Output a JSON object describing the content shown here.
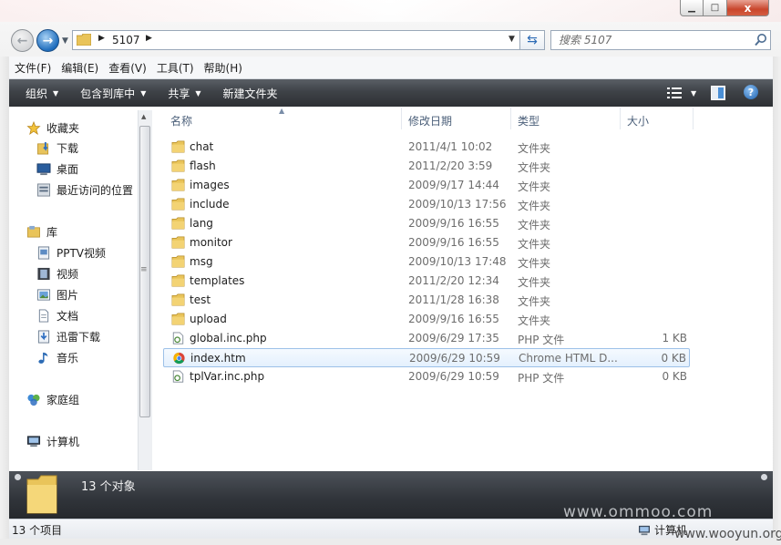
{
  "window": {
    "min_icon": "minimize-icon",
    "max_icon": "maximize-icon",
    "close_icon": "close-icon",
    "close_glyph": "x"
  },
  "address": {
    "crumb": "5107",
    "search_placeholder": "搜索 5107"
  },
  "menu": [
    "文件(F)",
    "编辑(E)",
    "查看(V)",
    "工具(T)",
    "帮助(H)"
  ],
  "commands": [
    {
      "label": "组织",
      "dropdown": true
    },
    {
      "label": "包含到库中",
      "dropdown": true
    },
    {
      "label": "共享",
      "dropdown": true
    },
    {
      "label": "新建文件夹",
      "dropdown": false
    }
  ],
  "help_glyph": "?",
  "nav": {
    "favorites": "收藏夹",
    "favorites_items": [
      "下载",
      "桌面",
      "最近访问的位置"
    ],
    "libraries": "库",
    "libraries_items": [
      "PPTV视频",
      "视频",
      "图片",
      "文档",
      "迅雷下载",
      "音乐"
    ],
    "homegroup": "家庭组",
    "computer": "计算机"
  },
  "columns": {
    "name": "名称",
    "date": "修改日期",
    "type": "类型",
    "size": "大小"
  },
  "files": [
    {
      "name": "chat",
      "date": "2011/4/1 10:02",
      "type": "文件夹",
      "size": "",
      "icon": "folder"
    },
    {
      "name": "flash",
      "date": "2011/2/20 3:59",
      "type": "文件夹",
      "size": "",
      "icon": "folder"
    },
    {
      "name": "images",
      "date": "2009/9/17 14:44",
      "type": "文件夹",
      "size": "",
      "icon": "folder"
    },
    {
      "name": "include",
      "date": "2009/10/13 17:56",
      "type": "文件夹",
      "size": "",
      "icon": "folder"
    },
    {
      "name": "lang",
      "date": "2009/9/16 16:55",
      "type": "文件夹",
      "size": "",
      "icon": "folder"
    },
    {
      "name": "monitor",
      "date": "2009/9/16 16:55",
      "type": "文件夹",
      "size": "",
      "icon": "folder"
    },
    {
      "name": "msg",
      "date": "2009/10/13 17:48",
      "type": "文件夹",
      "size": "",
      "icon": "folder"
    },
    {
      "name": "templates",
      "date": "2011/2/20 12:34",
      "type": "文件夹",
      "size": "",
      "icon": "folder"
    },
    {
      "name": "test",
      "date": "2011/1/28 16:38",
      "type": "文件夹",
      "size": "",
      "icon": "folder"
    },
    {
      "name": "upload",
      "date": "2009/9/16 16:55",
      "type": "文件夹",
      "size": "",
      "icon": "folder"
    },
    {
      "name": "global.inc.php",
      "date": "2009/6/29 17:35",
      "type": "PHP 文件",
      "size": "1 KB",
      "icon": "php-file"
    },
    {
      "name": "index.htm",
      "date": "2009/6/29 10:59",
      "type": "Chrome HTML D...",
      "size": "0 KB",
      "icon": "chrome-html-file",
      "selected": true
    },
    {
      "name": "tplVar.inc.php",
      "date": "2009/6/29 10:59",
      "type": "PHP 文件",
      "size": "0 KB",
      "icon": "php-file"
    }
  ],
  "details": {
    "count": "13 个对象"
  },
  "status": {
    "items": "13 个项目",
    "location": "计算机"
  },
  "watermarks": {
    "site1": "www.ommoo.com",
    "site2": "www.wooyun.org"
  }
}
